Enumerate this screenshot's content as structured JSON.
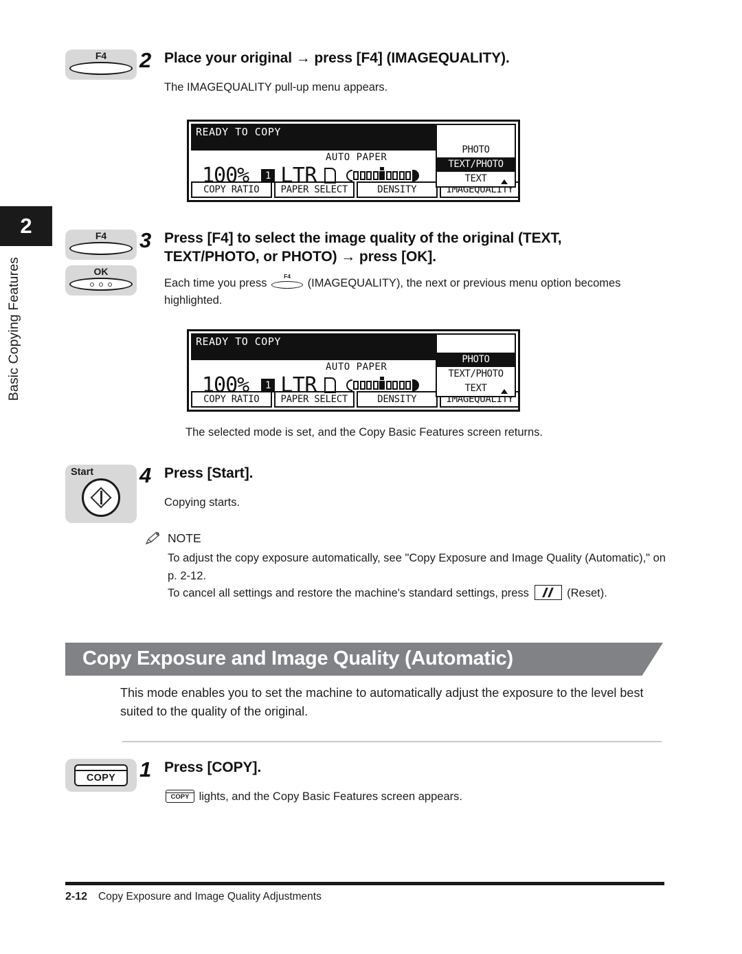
{
  "chapter_tab": {
    "number": "2",
    "label": "Basic Copying Features"
  },
  "steps": [
    {
      "number": "2",
      "key_label": "F4",
      "title": "Place your original → press [F4] (IMAGEQUALITY).",
      "description": "The IMAGEQUALITY pull-up menu appears."
    },
    {
      "number": "3",
      "key_label": "F4",
      "key_label_2": "OK",
      "title": "Press [F4] to select the image quality of the original (TEXT, TEXT/PHOTO, or PHOTO) → press [OK].",
      "desc_part1": "Each time you press",
      "inline_key": "F4",
      "desc_part2": "(IMAGEQUALITY), the next or previous menu option becomes highlighted.",
      "after_text": "The selected mode is set, and the Copy Basic Features screen returns."
    },
    {
      "number": "4",
      "key_label": "Start",
      "title": "Press [Start].",
      "description": "Copying starts."
    },
    {
      "number": "1",
      "key_label": "COPY",
      "title": "Press [COPY].",
      "desc_part1": "",
      "inline_key": "COPY",
      "desc_part2": "lights, and the Copy Basic Features screen appears."
    }
  ],
  "lcd_screen_1": {
    "status": "READY TO COPY",
    "auto_paper": "AUTO PAPER",
    "ratio": "100%",
    "cassette": "1",
    "paper_size": "LTR",
    "tabs": [
      "COPY RATIO",
      "PAPER SELECT",
      "DENSITY",
      "IMAGEQUALITY"
    ],
    "menu_items": [
      "PHOTO",
      "TEXT/PHOTO",
      "TEXT"
    ],
    "selected_menu_item": "TEXT/PHOTO"
  },
  "lcd_screen_2": {
    "status": "READY TO COPY",
    "auto_paper": "AUTO PAPER",
    "ratio": "100%",
    "cassette": "1",
    "paper_size": "LTR",
    "tabs": [
      "COPY RATIO",
      "PAPER SELECT",
      "DENSITY",
      "IMAGEQUALITY"
    ],
    "menu_items": [
      "PHOTO",
      "TEXT/PHOTO",
      "TEXT"
    ],
    "selected_menu_item": "PHOTO"
  },
  "note": {
    "heading": "NOTE",
    "line1": "To adjust the copy exposure automatically, see \"Copy Exposure and Image Quality (Automatic),\" on p. 2-12.",
    "line2_part1": "To cancel all settings and restore the machine's standard settings, press",
    "line2_part2": "(Reset)."
  },
  "section": {
    "banner_title": "Copy Exposure and Image Quality (Automatic)",
    "intro": "This mode enables you to set the machine to automatically adjust the exposure to the level best suited to the quality of the original."
  },
  "footer": {
    "page_number": "2-12",
    "running_head": "Copy Exposure and Image Quality Adjustments"
  },
  "colors": {
    "banner_gray": "#808285",
    "ink": "#1a1a1a",
    "keycap_gray": "#d8d8d8"
  }
}
